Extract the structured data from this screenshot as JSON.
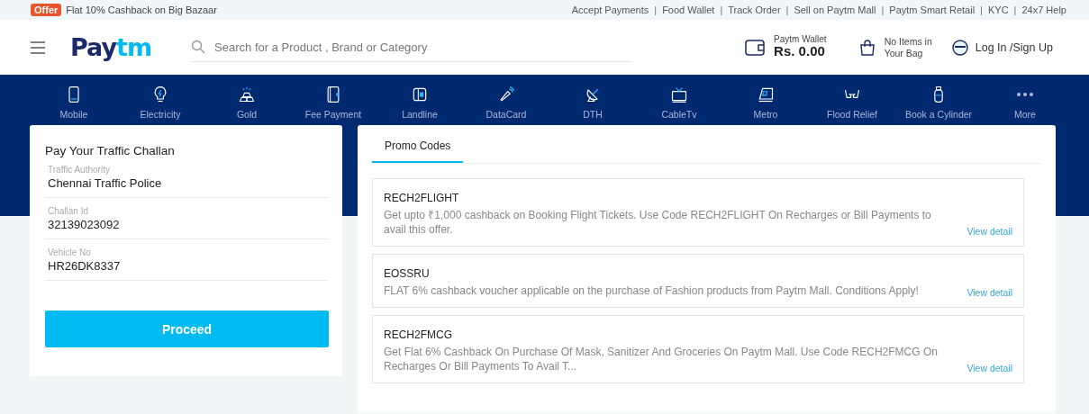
{
  "top_bar": {
    "offer_badge": "Offer",
    "offer_text": "Flat 10% Cashback on Big Bazaar",
    "links": [
      "Accept Payments",
      "Food Wallet",
      "Track Order",
      "Sell on Paytm Mall",
      "Paytm Smart Retail",
      "KYC",
      "24x7 Help"
    ],
    "separator": "|"
  },
  "header": {
    "logo": {
      "part_1": "Pay",
      "part_2": "tm"
    },
    "search": {
      "placeholder": "Search for a Product , Brand or Category"
    },
    "wallet": {
      "label": "Paytm Wallet",
      "amount": "Rs.  0.00"
    },
    "bag": {
      "line_1": "No Items in",
      "line_2": "Your Bag"
    },
    "login": "Log In /Sign Up"
  },
  "categories": [
    {
      "label": "Mobile"
    },
    {
      "label": "Electricity"
    },
    {
      "label": "Gold"
    },
    {
      "label": "Fee Payment"
    },
    {
      "label": "Landline"
    },
    {
      "label": "DataCard"
    },
    {
      "label": "DTH"
    },
    {
      "label": "CableTv"
    },
    {
      "label": "Metro"
    },
    {
      "label": "Flood Relief"
    },
    {
      "label": "Book a Cylinder"
    },
    {
      "label": "More"
    }
  ],
  "challan_form": {
    "title": "Pay Your Traffic Challan",
    "fields": [
      {
        "label": "Traffic Authority",
        "value": "Chennai Traffic Police"
      },
      {
        "label": "Challan Id",
        "value": "32139023092"
      },
      {
        "label": "Vehicle No",
        "value": "HR26DK8337"
      }
    ],
    "button": "Proceed"
  },
  "promo_panel": {
    "tabs": [
      {
        "label": "Promo Codes",
        "selected": true
      }
    ],
    "promos": [
      {
        "code": "RECH2FLIGHT",
        "description": "Get upto ₹1,000 cashback on Booking Flight Tickets. Use Code RECH2FLIGHT On Recharges or Bill Payments to avail this offer.",
        "link": "View detail"
      },
      {
        "code": "EOSSRU",
        "description": "FLAT 6% cashback voucher applicable on the purchase of Fashion products from Paytm Mall. Conditions Apply!",
        "link": "View detail"
      },
      {
        "code": "RECH2FMCG",
        "description": "Get Flat 6% Cashback On Purchase Of Mask, Sanitizer And Groceries On Paytm Mall. Use Code RECH2FMCG On Recharges Or Bill Payments To Avail T...",
        "link": "View detail"
      }
    ]
  }
}
